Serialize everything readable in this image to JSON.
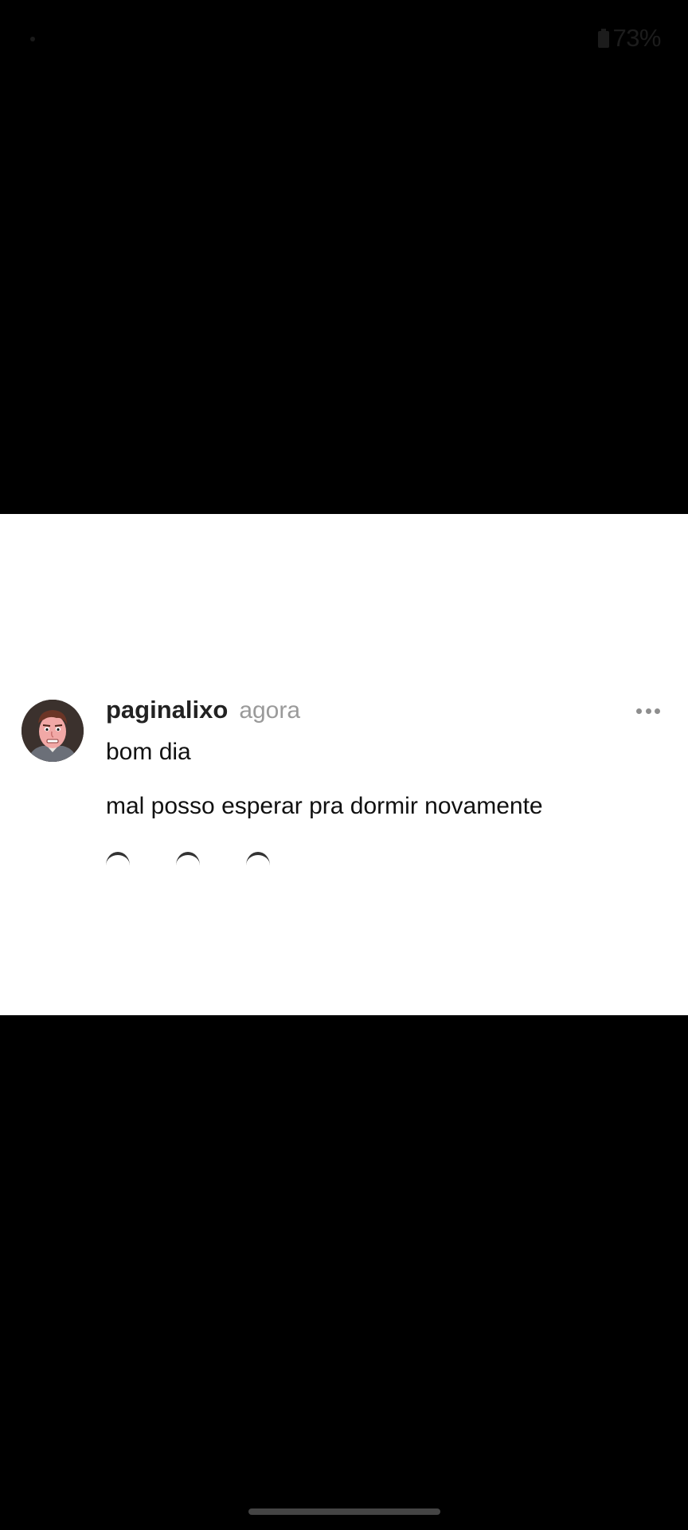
{
  "status_bar": {
    "battery_percent": "73%"
  },
  "post": {
    "username": "paginalixo",
    "time": "agora",
    "lines": [
      "bom dia",
      "mal posso esperar pra dormir novamente"
    ]
  }
}
